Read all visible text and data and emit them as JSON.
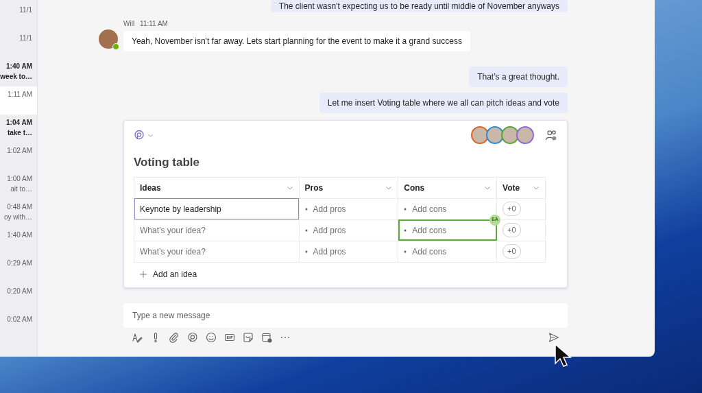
{
  "sidebar": {
    "items": [
      {
        "time": "11/1",
        "bold": false,
        "selected": false
      },
      {
        "time": "11/1",
        "bold": false,
        "selected": false
      },
      {
        "time": "1:40 AM",
        "preview": "week to…",
        "bold": true,
        "selected": false
      },
      {
        "time": "1:11 AM",
        "bold": false,
        "selected": true
      },
      {
        "time": "1:04 AM",
        "preview": "take t…",
        "bold": true,
        "selected": false
      },
      {
        "time": "1:02 AM",
        "bold": false,
        "selected": false
      },
      {
        "time": "1:00 AM",
        "preview": "ait to…",
        "bold": false,
        "selected": false
      },
      {
        "time": "0:48 AM",
        "preview": "oy with…",
        "bold": false,
        "selected": false
      },
      {
        "time": "1:40 AM",
        "bold": false,
        "selected": false
      },
      {
        "time": "0:29 AM",
        "bold": false,
        "selected": false
      },
      {
        "time": "0:20 AM",
        "bold": false,
        "selected": false
      },
      {
        "time": "0:02 AM",
        "bold": false,
        "selected": false
      }
    ]
  },
  "messages": [
    {
      "kind": "outgoing",
      "text": "The client wasn't expecting us to be ready until middle of November anyways"
    },
    {
      "kind": "incoming",
      "sender": "Will",
      "time": "11:11 AM",
      "online": true,
      "text": "Yeah, November isn't far away. Lets start planning for the event to make it a grand success"
    },
    {
      "kind": "outgoing",
      "text": "That’s a great thought."
    },
    {
      "kind": "outgoing",
      "text": "Let me insert Voting table where we all can pitch ideas and vote"
    }
  ],
  "loop_component": {
    "title": "Voting table",
    "collaborators": [
      {
        "color": "#d9652b"
      },
      {
        "color": "#2f8ad8"
      },
      {
        "color": "#5aa33a"
      },
      {
        "color": "#8f6ad6"
      }
    ],
    "columns": [
      {
        "label": "Ideas"
      },
      {
        "label": "Pros"
      },
      {
        "label": "Cons"
      },
      {
        "label": "Vote"
      }
    ],
    "rows": [
      {
        "idea": "Keynote by leadership",
        "idea_selected": true,
        "pros_placeholder": "Add pros",
        "cons_placeholder": "Add cons",
        "vote": "+0"
      },
      {
        "idea_placeholder": "What’s your idea?",
        "idea_selected": false,
        "pros_placeholder": "Add pros",
        "cons_placeholder": "Add cons",
        "cons_editor": {
          "initials": "EA",
          "color": "#b5dc96"
        },
        "vote": "+0"
      },
      {
        "idea_placeholder": "What’s your idea?",
        "idea_selected": false,
        "pros_placeholder": "Add pros",
        "cons_placeholder": "Add cons",
        "vote": "+0"
      }
    ],
    "add_label": "Add an idea"
  },
  "composer": {
    "placeholder": "Type a new message"
  }
}
